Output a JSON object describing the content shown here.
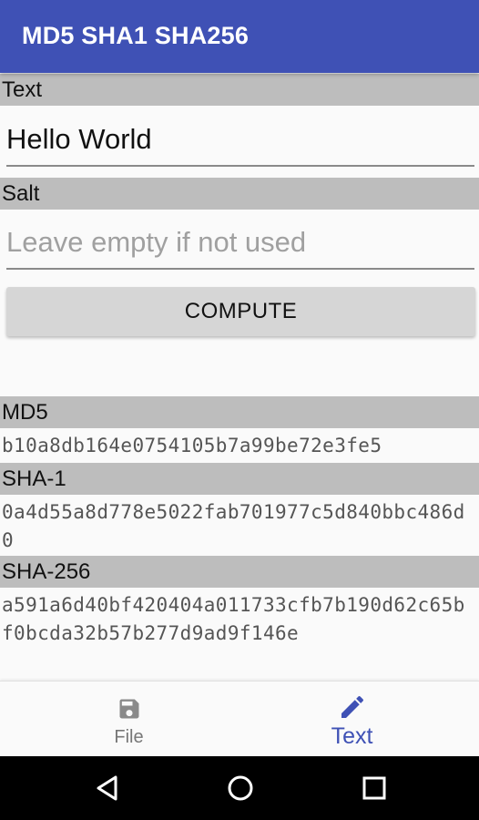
{
  "app": {
    "title": "MD5 SHA1 SHA256"
  },
  "text_section": {
    "label": "Text",
    "value": "Hello World"
  },
  "salt_section": {
    "label": "Salt",
    "value": "",
    "placeholder": "Leave empty if not used"
  },
  "compute": {
    "label": "COMPUTE"
  },
  "results": {
    "md5": {
      "label": "MD5",
      "value": "b10a8db164e0754105b7a99be72e3fe5"
    },
    "sha1": {
      "label": "SHA-1",
      "value": "0a4d55a8d778e5022fab701977c5d840bbc486d0"
    },
    "sha256": {
      "label": "SHA-256",
      "value": "a591a6d40bf420404a011733cfb7b190d62c65bf0bcda32b57b277d9ad9f146e"
    }
  },
  "bottom_nav": {
    "file": {
      "label": "File",
      "icon": "floppy-disk-icon"
    },
    "text": {
      "label": "Text",
      "icon": "pencil-icon",
      "selected": true
    }
  },
  "system_nav": {
    "back_icon": "back-triangle-icon",
    "home_icon": "home-circle-icon",
    "recents_icon": "recents-square-icon"
  },
  "colors": {
    "primary": "#3f51b5",
    "section_header_bg": "#bdbdbd",
    "button_bg": "#d6d6d6",
    "inactive_nav": "#777777"
  }
}
